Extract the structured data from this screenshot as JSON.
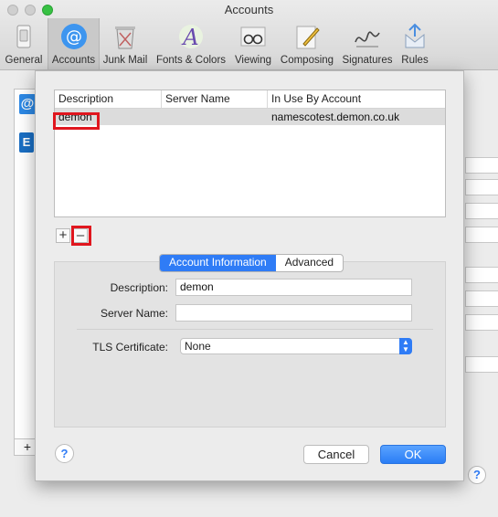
{
  "window": {
    "title": "Accounts"
  },
  "toolbar": {
    "items": [
      {
        "label": "General",
        "icon": "general-switch-icon"
      },
      {
        "label": "Accounts",
        "icon": "at-sign-icon",
        "selected": true
      },
      {
        "label": "Junk Mail",
        "icon": "trash-icon"
      },
      {
        "label": "Fonts & Colors",
        "icon": "fonts-colors-icon"
      },
      {
        "label": "Viewing",
        "icon": "glasses-icon"
      },
      {
        "label": "Composing",
        "icon": "pencil-icon"
      },
      {
        "label": "Signatures",
        "icon": "signature-icon"
      },
      {
        "label": "Rules",
        "icon": "rules-icon"
      }
    ]
  },
  "background": {
    "list_plus": "+",
    "help": "?"
  },
  "sheet": {
    "table": {
      "columns": [
        "Description",
        "Server Name",
        "In Use By Account"
      ],
      "rows": [
        {
          "description": "demon",
          "server_name": "",
          "in_use_by": "namescotest.demon.co.uk"
        }
      ]
    },
    "add_button": "+",
    "remove_button": "–",
    "tabs": {
      "account_information": "Account Information",
      "advanced": "Advanced"
    },
    "form": {
      "description_label": "Description:",
      "description_value": "demon",
      "server_name_label": "Server Name:",
      "server_name_value": "",
      "tls_label": "TLS Certificate:",
      "tls_value": "None"
    },
    "help": "?",
    "cancel": "Cancel",
    "ok": "OK"
  },
  "colors": {
    "accent": "#2f7cf6",
    "highlight_box": "#e0161e"
  }
}
